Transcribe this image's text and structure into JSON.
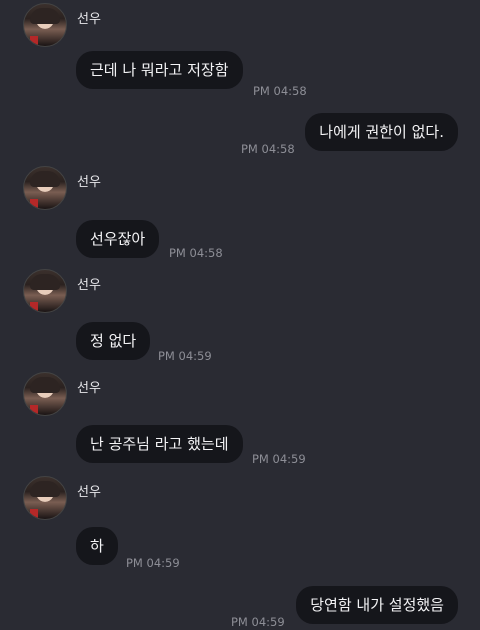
{
  "messages": [
    {
      "side": "in",
      "sender": "선우",
      "text": "근데 나 뭐라고 저장함",
      "time": "PM 04:58"
    },
    {
      "side": "out",
      "text": "나에게 권한이 없다.",
      "time": "PM 04:58"
    },
    {
      "side": "in",
      "sender": "선우",
      "text": "선우잖아",
      "time": "PM 04:58"
    },
    {
      "side": "in",
      "sender": "선우",
      "text": "정 없다",
      "time": "PM 04:59"
    },
    {
      "side": "in",
      "sender": "선우",
      "text": "난 공주님 라고 했는데",
      "time": "PM 04:59"
    },
    {
      "side": "in",
      "sender": "선우",
      "text": "하",
      "time": "PM 04:59"
    },
    {
      "side": "out",
      "text": "당연함 내가 설정했음",
      "time": "PM 04:59"
    }
  ]
}
